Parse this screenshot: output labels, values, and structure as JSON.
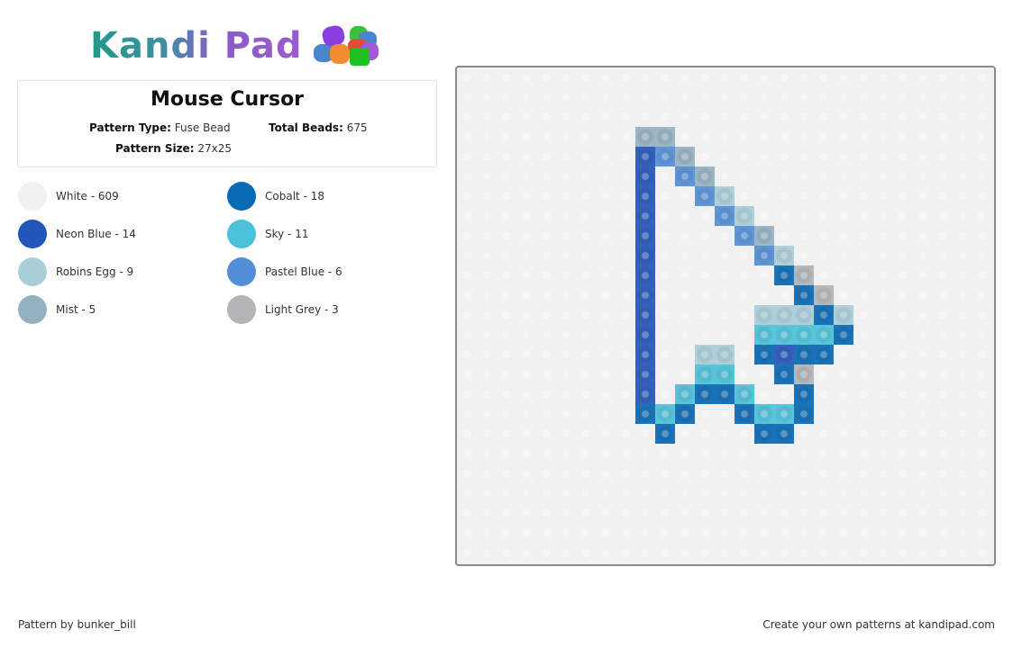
{
  "logo": {
    "text": "Kandi Pad"
  },
  "pattern": {
    "title": "Mouse Cursor",
    "type_label": "Pattern Type:",
    "type_value": "Fuse Bead",
    "total_label": "Total Beads:",
    "total_value": "675",
    "size_label": "Pattern Size:",
    "size_value": "27x25",
    "columns": 27,
    "rows": 25
  },
  "legend": [
    {
      "key": "W",
      "name": "White",
      "count": 609,
      "label": "White - 609",
      "color": "#f1f1f1"
    },
    {
      "key": "C",
      "name": "Cobalt",
      "count": 18,
      "label": "Cobalt - 18",
      "color": "#0869b4"
    },
    {
      "key": "N",
      "name": "Neon Blue",
      "count": 14,
      "label": "Neon Blue - 14",
      "color": "#2455b8"
    },
    {
      "key": "S",
      "name": "Sky",
      "count": 11,
      "label": "Sky - 11",
      "color": "#4cc2da"
    },
    {
      "key": "R",
      "name": "Robins Egg",
      "count": 9,
      "label": "Robins Egg - 9",
      "color": "#a9ced8"
    },
    {
      "key": "P",
      "name": "Pastel Blue",
      "count": 6,
      "label": "Pastel Blue - 6",
      "color": "#538fd6"
    },
    {
      "key": "M",
      "name": "Mist",
      "count": 5,
      "label": "Mist - 5",
      "color": "#94b1c1"
    },
    {
      "key": "G",
      "name": "Light Grey",
      "count": 3,
      "label": "Light Grey - 3",
      "color": "#b3b4b5"
    }
  ],
  "grid": [
    "...........................",
    "...........................",
    "...........................",
    ".........MM................",
    ".........NPM...............",
    ".........N.PM..............",
    ".........N..PR.............",
    ".........N...PR............",
    ".........N....PM...........",
    ".........N.....PR..........",
    ".........N......CG.........",
    ".........N.......CG........",
    ".........N.....RRRCR.......",
    ".........N.....SSSSC.......",
    ".........N..RR.CNCC........",
    ".........N..SS..CG.........",
    ".........N.SCCS..C.........",
    ".........CSC..CSSC.........",
    "..........C....CC..........",
    "...........................",
    "...........................",
    "...........................",
    "...........................",
    "...........................",
    "..........................."
  ],
  "footer": {
    "credit": "Pattern by bunker_bill",
    "promo": "Create your own patterns at kandipad.com"
  }
}
